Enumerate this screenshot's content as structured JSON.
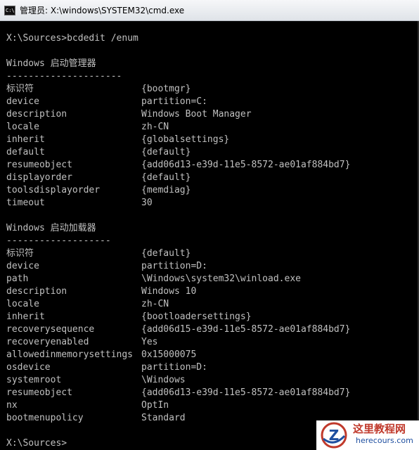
{
  "window": {
    "title": "管理员: X:\\windows\\SYSTEM32\\cmd.exe",
    "icon": "cmd-icon",
    "icon_text": "C:\\"
  },
  "console": {
    "command": "X:\\Sources>bcdedit /enum",
    "boot_manager": {
      "heading": "Windows 启动管理器",
      "separator": "---------------------",
      "entries": [
        {
          "key": "标识符",
          "value": "{bootmgr}"
        },
        {
          "key": "device",
          "value": "partition=C:"
        },
        {
          "key": "description",
          "value": "Windows Boot Manager"
        },
        {
          "key": "locale",
          "value": "zh-CN"
        },
        {
          "key": "inherit",
          "value": "{globalsettings}"
        },
        {
          "key": "default",
          "value": "{default}"
        },
        {
          "key": "resumeobject",
          "value": "{add06d13-e39d-11e5-8572-ae01af884bd7}"
        },
        {
          "key": "displayorder",
          "value": "{default}"
        },
        {
          "key": "toolsdisplayorder",
          "value": "{memdiag}"
        },
        {
          "key": "timeout",
          "value": "30"
        }
      ]
    },
    "boot_loader": {
      "heading": "Windows 启动加载器",
      "separator": "-------------------",
      "entries": [
        {
          "key": "标识符",
          "value": "{default}"
        },
        {
          "key": "device",
          "value": "partition=D:"
        },
        {
          "key": "path",
          "value": "\\Windows\\system32\\winload.exe"
        },
        {
          "key": "description",
          "value": "Windows 10"
        },
        {
          "key": "locale",
          "value": "zh-CN"
        },
        {
          "key": "inherit",
          "value": "{bootloadersettings}"
        },
        {
          "key": "recoverysequence",
          "value": "{add06d15-e39d-11e5-8572-ae01af884bd7}"
        },
        {
          "key": "recoveryenabled",
          "value": "Yes"
        },
        {
          "key": "allowedinmemorysettings",
          "value": "0x15000075"
        },
        {
          "key": "osdevice",
          "value": "partition=D:"
        },
        {
          "key": "systemroot",
          "value": "\\Windows"
        },
        {
          "key": "resumeobject",
          "value": "{add06d13-e39d-11e5-8572-ae01af884bd7}"
        },
        {
          "key": "nx",
          "value": "OptIn"
        },
        {
          "key": "bootmenupolicy",
          "value": "Standard"
        }
      ]
    },
    "prompt": "X:\\Sources>"
  },
  "watermark": {
    "title": "这里教程网",
    "url": "herecours.com",
    "logo_letter": "Z"
  },
  "colors": {
    "console_bg": "#000000",
    "console_fg": "#c0c0c0",
    "watermark_red": "#c0392b",
    "watermark_blue": "#1f4fa0"
  }
}
